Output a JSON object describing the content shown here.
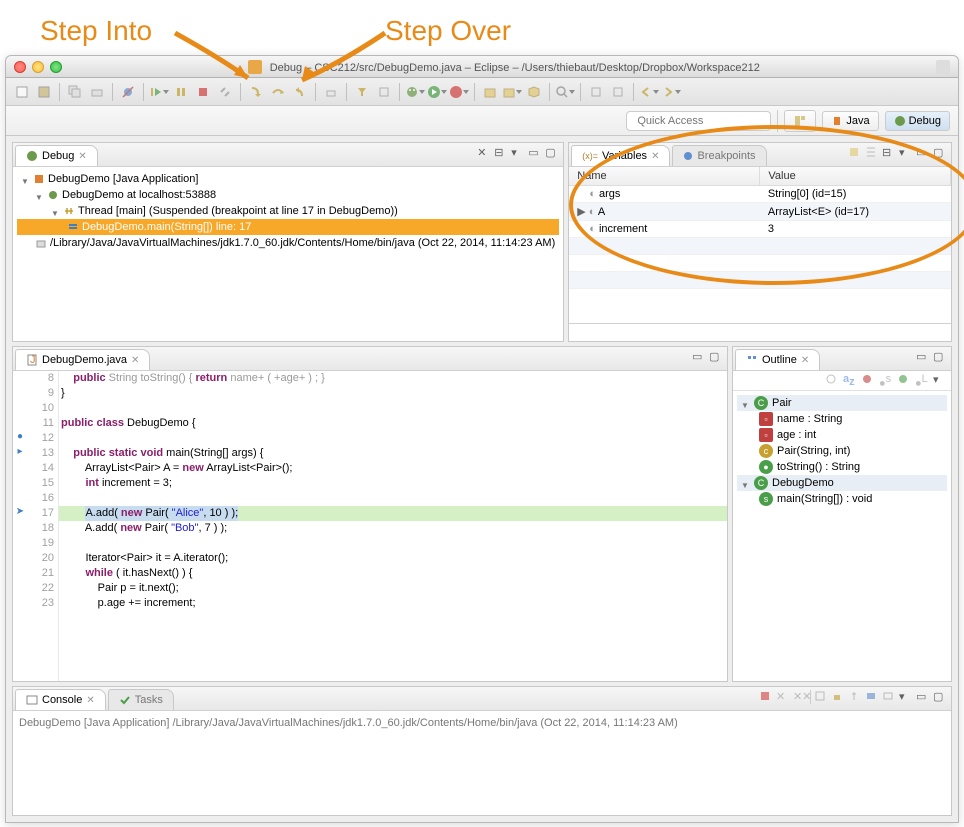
{
  "annotations": {
    "step_into": "Step Into",
    "step_over": "Step Over"
  },
  "window": {
    "title": "Debug – CSC212/src/DebugDemo.java – Eclipse – /Users/thiebaut/Desktop/Dropbox/Workspace212"
  },
  "quick_access": {
    "placeholder": "Quick Access"
  },
  "perspectives": {
    "java": "Java",
    "debug": "Debug"
  },
  "debug_view": {
    "tab": "Debug",
    "tree": [
      "DebugDemo [Java Application]",
      "DebugDemo at localhost:53888",
      "Thread [main] (Suspended (breakpoint at line 17 in DebugDemo))",
      "DebugDemo.main(String[]) line: 17",
      "/Library/Java/JavaVirtualMachines/jdk1.7.0_60.jdk/Contents/Home/bin/java (Oct 22, 2014, 11:14:23 AM)"
    ]
  },
  "variables_view": {
    "tab_vars": "Variables",
    "tab_bp": "Breakpoints",
    "col_name": "Name",
    "col_value": "Value",
    "rows": [
      {
        "name": "args",
        "value": "String[0]  (id=15)"
      },
      {
        "name": "A",
        "value": "ArrayList<E>  (id=17)"
      },
      {
        "name": "increment",
        "value": "3"
      }
    ]
  },
  "editor": {
    "tab": "DebugDemo.java",
    "lines": [
      {
        "n": 8,
        "t": "    public String toString() { return name+ ( +age+ ) ; }"
      },
      {
        "n": 9,
        "t": "}"
      },
      {
        "n": 10,
        "t": ""
      },
      {
        "n": 11,
        "t": "public class DebugDemo {"
      },
      {
        "n": 12,
        "t": ""
      },
      {
        "n": 13,
        "t": "    public static void main(String[] args) {"
      },
      {
        "n": 14,
        "t": "        ArrayList<Pair> A = new ArrayList<Pair>();"
      },
      {
        "n": 15,
        "t": "        int increment = 3;"
      },
      {
        "n": 16,
        "t": ""
      },
      {
        "n": 17,
        "t": "        A.add( new Pair( \"Alice\", 10 ) );"
      },
      {
        "n": 18,
        "t": "        A.add( new Pair( \"Bob\", 7 ) );"
      },
      {
        "n": 19,
        "t": ""
      },
      {
        "n": 20,
        "t": "        Iterator<Pair> it = A.iterator();"
      },
      {
        "n": 21,
        "t": "        while ( it.hasNext() ) {"
      },
      {
        "n": 22,
        "t": "            Pair p = it.next();"
      },
      {
        "n": 23,
        "t": "            p.age += increment;"
      }
    ],
    "highlight_line": 17
  },
  "outline": {
    "tab": "Outline",
    "items": [
      {
        "label": "Pair",
        "type": "class",
        "indent": 0
      },
      {
        "label": "name : String",
        "type": "field",
        "indent": 1
      },
      {
        "label": "age : int",
        "type": "field",
        "indent": 1
      },
      {
        "label": "Pair(String, int)",
        "type": "ctor",
        "indent": 1
      },
      {
        "label": "toString() : String",
        "type": "method",
        "indent": 1
      },
      {
        "label": "DebugDemo",
        "type": "class",
        "indent": 0
      },
      {
        "label": "main(String[]) : void",
        "type": "smethod",
        "indent": 1
      }
    ]
  },
  "console": {
    "tab_console": "Console",
    "tab_tasks": "Tasks",
    "header": "DebugDemo [Java Application] /Library/Java/JavaVirtualMachines/jdk1.7.0_60.jdk/Contents/Home/bin/java (Oct 22, 2014, 11:14:23 AM)"
  }
}
